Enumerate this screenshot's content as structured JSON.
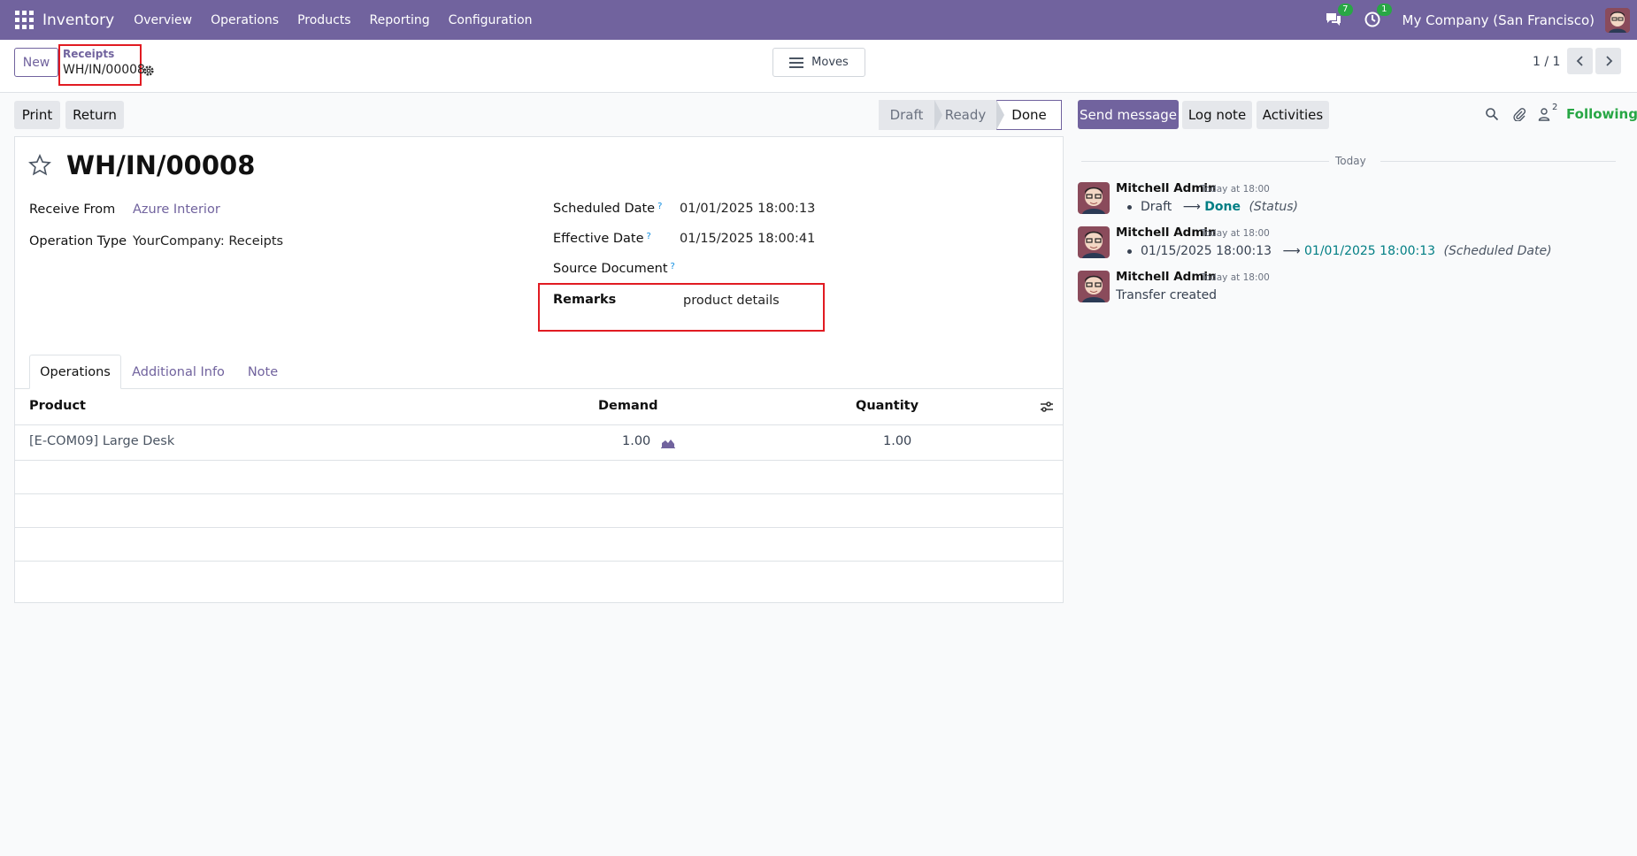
{
  "navbar": {
    "app_name": "Inventory",
    "menu": [
      "Overview",
      "Operations",
      "Products",
      "Reporting",
      "Configuration"
    ],
    "messages_count": "7",
    "activities_count": "1",
    "company": "My Company (San Francisco)"
  },
  "control": {
    "new_label": "New",
    "breadcrumb_parent": "Receipts",
    "breadcrumb_current": "WH/IN/00008",
    "moves_label": "Moves",
    "pager": "1 / 1"
  },
  "actions": {
    "print_label": "Print",
    "return_label": "Return"
  },
  "status": {
    "stages": [
      "Draft",
      "Ready",
      "Done"
    ],
    "current": "Done"
  },
  "form": {
    "title": "WH/IN/00008",
    "receive_from_label": "Receive From",
    "receive_from_value": "Azure Interior",
    "operation_type_label": "Operation Type",
    "operation_type_value": "YourCompany: Receipts",
    "scheduled_date_label": "Scheduled Date",
    "scheduled_date_value": "01/01/2025 18:00:13",
    "effective_date_label": "Effective Date",
    "effective_date_value": "01/15/2025 18:00:41",
    "source_document_label": "Source Document",
    "source_document_value": "",
    "remarks_label": "Remarks",
    "remarks_value": "product details",
    "help_mark": "?"
  },
  "tabs": [
    "Operations",
    "Additional Info",
    "Note"
  ],
  "table": {
    "headers": {
      "product": "Product",
      "demand": "Demand",
      "quantity": "Quantity"
    },
    "rows": [
      {
        "product": "[E-COM09] Large Desk",
        "demand": "1.00",
        "quantity": "1.00"
      }
    ]
  },
  "chatter": {
    "send_message": "Send message",
    "log_note": "Log note",
    "activities": "Activities",
    "followers_count": "2",
    "following": "Following",
    "date_separator": "Today",
    "messages": [
      {
        "author": "Mitchell Admin",
        "time": "Today at 18:00",
        "old": "Draft",
        "arrow": "⟶",
        "new": "Done",
        "field": "(Status)"
      },
      {
        "author": "Mitchell Admin",
        "time": "Today at 18:00",
        "old": "01/15/2025 18:00:13",
        "arrow": "⟶",
        "new": "01/01/2025 18:00:13",
        "field": "(Scheduled Date)"
      },
      {
        "author": "Mitchell Admin",
        "time": "Today at 18:00",
        "body": "Transfer created"
      }
    ]
  },
  "colors": {
    "brand": "#71639e",
    "highlight": "#e11b22",
    "teal": "#017e84",
    "following": "#28a745"
  }
}
